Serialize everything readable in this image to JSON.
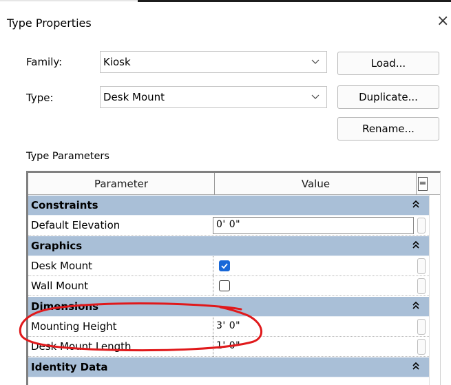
{
  "window": {
    "title": "Type Properties",
    "close_glyph": "×"
  },
  "family": {
    "label": "Family:",
    "value": "Kiosk"
  },
  "type": {
    "label": "Type:",
    "value": "Desk Mount"
  },
  "buttons": {
    "load": "Load...",
    "duplicate": "Duplicate...",
    "rename": "Rename..."
  },
  "type_parameters": {
    "title": "Type Parameters",
    "columns": {
      "parameter": "Parameter",
      "value": "Value",
      "eq": "="
    },
    "collapse_glyph": "⬆",
    "groups": {
      "constraints": {
        "name": "Constraints",
        "default_elevation": {
          "name": "Default Elevation",
          "value": "0'  0\""
        }
      },
      "graphics": {
        "name": "Graphics",
        "desk_mount": {
          "name": "Desk Mount",
          "checked": true
        },
        "wall_mount": {
          "name": "Wall Mount",
          "checked": false
        }
      },
      "dimensions": {
        "name": "Dimensions",
        "mounting_height": {
          "name": "Mounting Height",
          "value": "3'  0\""
        },
        "desk_mount_length": {
          "name": "Desk Mount Length",
          "value": "1'  0\""
        }
      },
      "identity": {
        "name": "Identity Data"
      }
    }
  },
  "annotation": {
    "color": "#e0191b"
  },
  "colors": {
    "category_bg": "#a9bfd7",
    "checkbox_on": "#1868d8"
  }
}
